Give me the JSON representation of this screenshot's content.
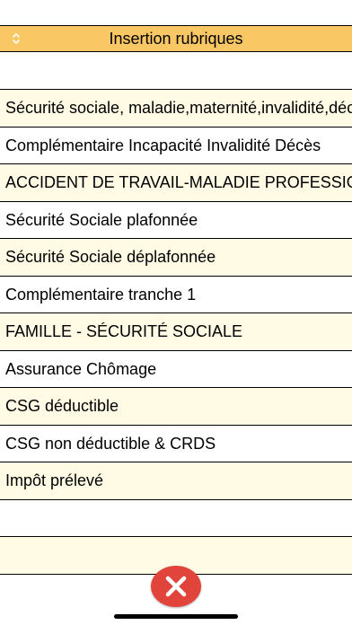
{
  "header": {
    "title": "Insertion rubriques",
    "sort_icon": "sort-arrows-icon"
  },
  "list": {
    "items": [
      "",
      "Sécurité sociale, maladie,maternité,invalidité,décès",
      "Complémentaire Incapacité Invalidité Décès",
      "ACCIDENT DE TRAVAIL-MALADIE PROFESSIONNELLE",
      "Sécurité Sociale plafonnée",
      "Sécurité Sociale déplafonnée",
      "Complémentaire tranche 1",
      "FAMILLE - SÉCURITÉ SOCIALE",
      "Assurance Chômage",
      "CSG déductible",
      "CSG non déductible & CRDS",
      "Impôt prélevé",
      "",
      ""
    ]
  },
  "close_button": {
    "icon": "close-x-icon"
  },
  "colors": {
    "header_bg": "#f9c864",
    "row_alt_bg": "#fffbe4",
    "close_bg": "#e0443a"
  }
}
